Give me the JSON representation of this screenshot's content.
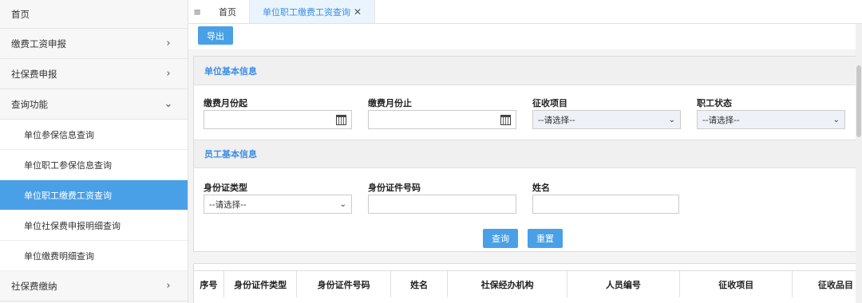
{
  "sidebar": {
    "home": "首页",
    "items": [
      {
        "label": "缴费工资申报",
        "chevron": "›"
      },
      {
        "label": "社保费申报",
        "chevron": "›"
      },
      {
        "label": "查询功能",
        "chevron": "⌄"
      }
    ],
    "sub_items": [
      {
        "label": "单位参保信息查询"
      },
      {
        "label": "单位职工参保信息查询"
      },
      {
        "label": "单位职工缴费工资查询"
      },
      {
        "label": "单位社保费申报明细查询"
      },
      {
        "label": "单位缴费明细查询"
      }
    ],
    "last_item": {
      "label": "社保费缴纳",
      "chevron": "›"
    }
  },
  "tabs": {
    "menu_icon": "≡",
    "home": "首页",
    "active": "单位职工缴费工资查询",
    "close": "✕"
  },
  "toolbar": {
    "export": "导出"
  },
  "unit_section": {
    "title": "单位基本信息",
    "month_from_label": "缴费月份起",
    "month_to_label": "缴费月份止",
    "collect_item_label": "征收项目",
    "collect_item_value": "--请选择--",
    "staff_status_label": "职工状态",
    "staff_status_value": "--请选择--"
  },
  "staff_section": {
    "title": "员工基本信息",
    "id_type_label": "身份证类型",
    "id_type_value": "--请选择--",
    "id_no_label": "身份证件号码",
    "name_label": "姓名"
  },
  "buttons": {
    "query": "查询",
    "reset": "重置"
  },
  "table": {
    "headers": [
      "序号",
      "身份证件类型",
      "身份证件号码",
      "姓名",
      "社保经办机构",
      "人员编号",
      "征收项目",
      "征收品目"
    ]
  },
  "colors": {
    "accent": "#4aa0e6",
    "section_title": "#3a8ee6"
  }
}
